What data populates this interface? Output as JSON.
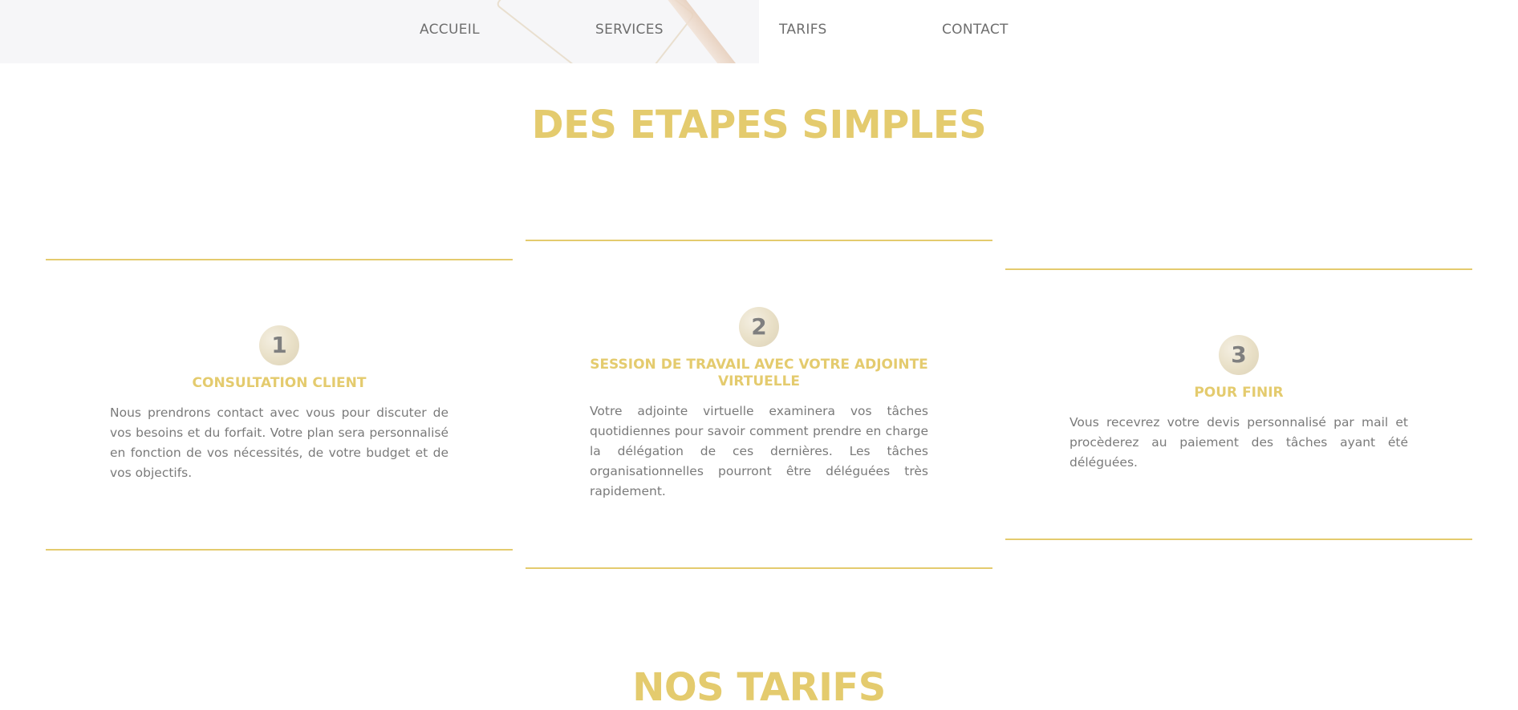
{
  "nav": {
    "items": [
      {
        "label": "ACCUEIL"
      },
      {
        "label": "SERVICES"
      },
      {
        "label": "TARIFS"
      },
      {
        "label": "CONTACT"
      }
    ]
  },
  "steps_section": {
    "title": "DES ETAPES SIMPLES",
    "steps": [
      {
        "number": "1",
        "title": "CONSULTATION CLIENT",
        "text": "Nous prendrons contact avec vous pour discuter de vos besoins et du forfait. Votre plan sera personnalisé en fonction de vos nécessités, de votre budget et de vos objectifs."
      },
      {
        "number": "2",
        "title": "SESSION DE TRAVAIL AVEC VOTRE ADJOINTE VIRTUELLE",
        "text": "Votre adjointe virtuelle examinera vos tâches quotidiennes pour savoir comment prendre en charge la délégation de ces dernières. Les tâches organisationnelles pourront être déléguées très rapidement."
      },
      {
        "number": "3",
        "title": "POUR FINIR",
        "text": "Vous recevrez votre devis personnalisé par mail et procèderez au paiement des tâches ayant été déléguées."
      }
    ]
  },
  "pricing_section": {
    "title": "NOS TARIFS"
  },
  "colors": {
    "accent": "#e4cb6e",
    "text": "#7a7a7a",
    "nav_background": "#f6f6f8"
  }
}
